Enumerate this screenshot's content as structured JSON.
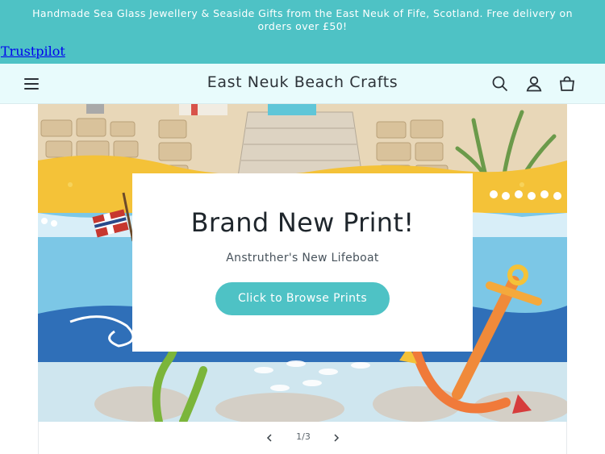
{
  "announcement": {
    "line1": "Handmade Sea Glass Jewellery & Seaside Gifts from the East Neuk of Fife, Scotland. Free delivery on",
    "line2": "orders over £50!"
  },
  "trustpilot": {
    "label": "Trustpilot"
  },
  "header": {
    "brand": "East Neuk Beach Crafts",
    "icons": [
      "menu-icon",
      "search-icon",
      "account-icon",
      "cart-icon"
    ]
  },
  "hero": {
    "title": "Brand New Print!",
    "subtitle": "Anstruther's New Lifeboat",
    "cta": "Click to Browse Prints"
  },
  "slider": {
    "counter": "1/3"
  },
  "colors": {
    "accent": "#4ec2c5",
    "header_bg": "#e8fbfc",
    "sand": "#f4c238",
    "sea": "#2f6fb8"
  }
}
